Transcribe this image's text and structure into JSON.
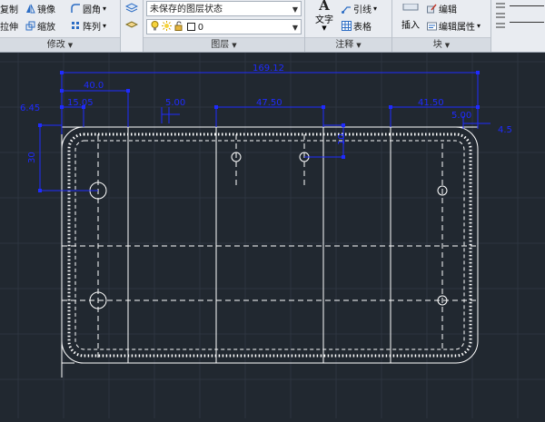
{
  "ribbon": {
    "modify": {
      "title": "修改",
      "copy": "复制",
      "mirror": "镜像",
      "fillet": "圆角",
      "stretch": "拉伸",
      "scale": "缩放",
      "array": "阵列"
    },
    "layers": {
      "title": "图层",
      "layer_state": "未保存的图层状态",
      "current_layer": "0"
    },
    "annotation": {
      "title": "注释",
      "text": "文字",
      "leader": "引线",
      "table": "表格"
    },
    "block": {
      "title": "块",
      "insert": "插入",
      "edit": "编辑",
      "edit_attributes": "编辑属性"
    }
  },
  "drawing": {
    "dimensions": {
      "overall_width": "169.12",
      "left_offset": "40.0",
      "left_small": "15.05",
      "left_vertical": "6.45",
      "center_small": "5.00",
      "center_span": "47.50",
      "right_span": "41.50",
      "right_small": "5.00",
      "right_vertical": "4.5",
      "left_height": "30",
      "hole_vertical": "10"
    }
  },
  "colors": {
    "ribbon_bg": "#e9ecf1",
    "canvas_bg": "#212830",
    "grid": "#2e3742",
    "geometry": "#ffffff",
    "dimension": "#1f2bff"
  }
}
